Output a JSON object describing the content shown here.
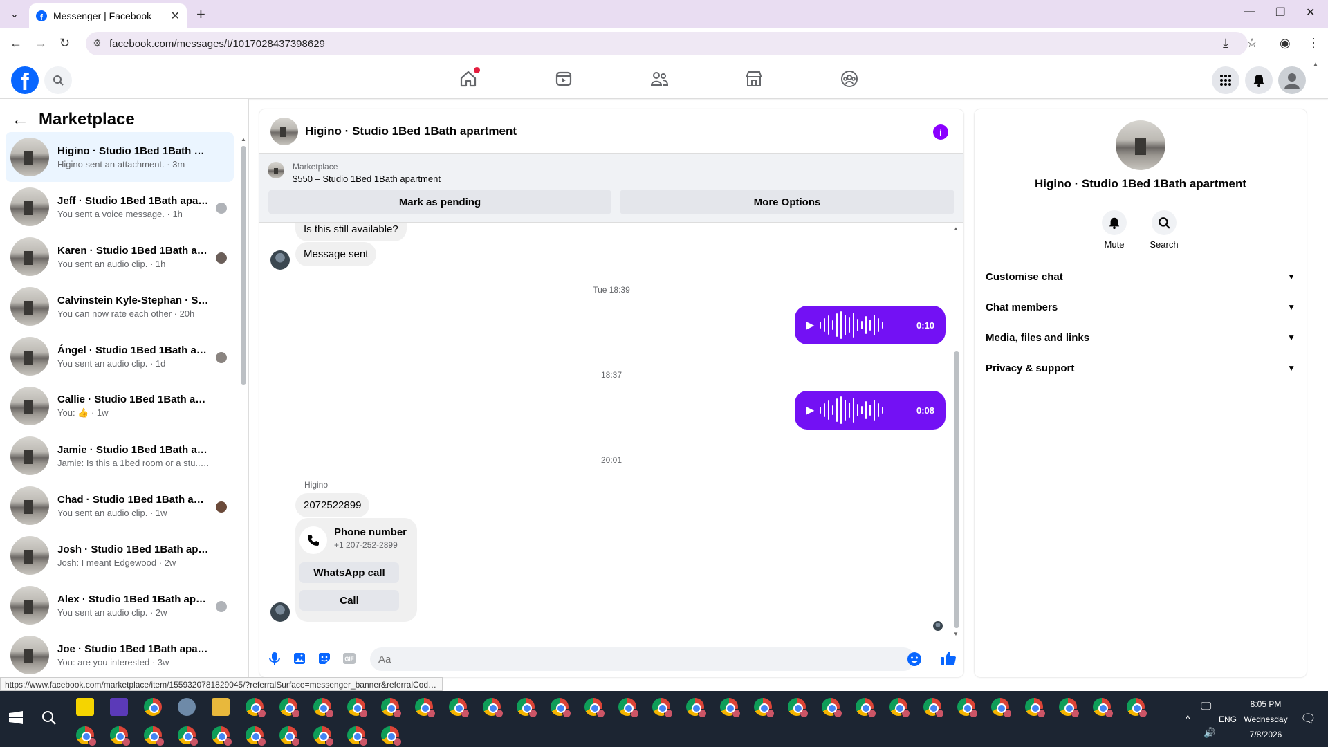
{
  "browser": {
    "tab_title": "Messenger | Facebook",
    "url": "facebook.com/messages/t/1017028437398629",
    "status_url": "https://www.facebook.com/marketplace/item/1559320781829045/?referralSurface=messenger_banner&referralCode..."
  },
  "sidebar": {
    "title": "Marketplace",
    "conversations": [
      {
        "name": "Higino · Studio 1Bed 1Bath apart...",
        "preview": "Higino sent an attachment. · 3m"
      },
      {
        "name": "Jeff · Studio 1Bed 1Bath apart...",
        "preview": "You sent a voice message. · 1h"
      },
      {
        "name": "Karen · Studio 1Bed 1Bath apa...",
        "preview": "You sent an audio clip. · 1h"
      },
      {
        "name": "Calvinstein Kyle-Stephan · Studi...",
        "preview": "You can now rate each other · 20h"
      },
      {
        "name": "Ángel · Studio 1Bed 1Bath apa...",
        "preview": "You sent an audio clip. · 1d"
      },
      {
        "name": "Callie · Studio 1Bed 1Bath apart...",
        "preview": "You: 👍 · 1w"
      },
      {
        "name": "Jamie · Studio 1Bed 1Bath apart...",
        "preview": "Jamie: Is this a 1bed room or a stu... · 1w"
      },
      {
        "name": "Chad · Studio 1Bed 1Bath apar...",
        "preview": "You sent an audio clip. · 1w"
      },
      {
        "name": "Josh · Studio 1Bed 1Bath apartm...",
        "preview": "Josh: I meant Edgewood · 2w"
      },
      {
        "name": "Alex · Studio 1Bed 1Bath apart...",
        "preview": "You sent an audio clip. · 2w"
      },
      {
        "name": "Joe · Studio 1Bed 1Bath apartment",
        "preview": "You: are you interested · 3w"
      }
    ]
  },
  "chat": {
    "title": "Higino · Studio 1Bed 1Bath apartment",
    "banner_label": "Marketplace",
    "banner_listing": "$550 – Studio 1Bed 1Bath apartment",
    "mark_pending": "Mark as pending",
    "more_options": "More Options",
    "msg_available": "Is this still available?",
    "msg_sent": "Message sent",
    "time1": "Tue 18:39",
    "voice1_duration": "0:10",
    "time2": "18:37",
    "voice2_duration": "0:08",
    "time3": "20:01",
    "sender": "Higino",
    "phone_msg": "2072522899",
    "phone_title": "Phone number",
    "phone_value": "+1 207-252-2899",
    "whatsapp": "WhatsApp call",
    "call": "Call",
    "input_placeholder": "Aa"
  },
  "details": {
    "title": "Higino · Studio 1Bed 1Bath apartment",
    "mute": "Mute",
    "search": "Search",
    "sections": [
      "Customise chat",
      "Chat members",
      "Media, files and links",
      "Privacy & support"
    ]
  },
  "taskbar": {
    "time": "8:05 PM",
    "day": "Wednesday",
    "date": "7/8/2026",
    "lang": "ENG"
  },
  "colors": {
    "accent": "#0866ff",
    "voice_bubble": "#7311f4",
    "info": "#8a00ff"
  }
}
